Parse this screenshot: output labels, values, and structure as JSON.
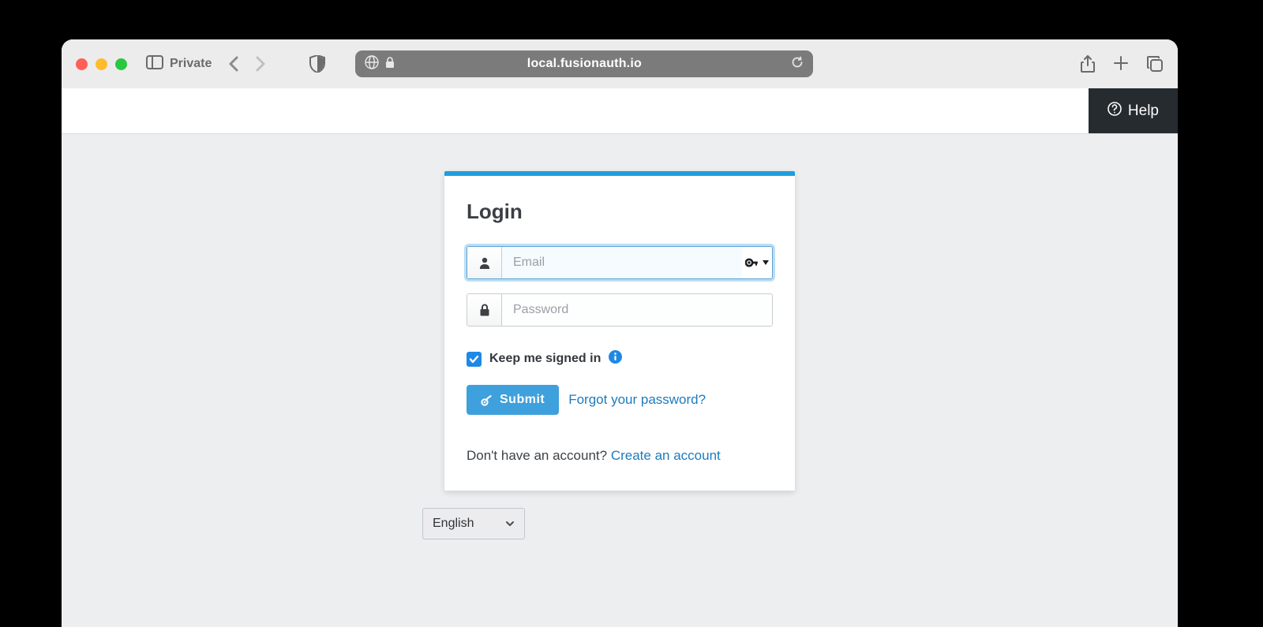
{
  "browser": {
    "mode_label": "Private",
    "url": "local.fusionauth.io"
  },
  "header": {
    "help_label": "Help"
  },
  "login": {
    "title": "Login",
    "email_placeholder": "Email",
    "password_placeholder": "Password",
    "remember_label": "Keep me signed in",
    "submit_label": "Submit",
    "forgot_label": "Forgot your password?",
    "no_account_label": "Don't have an account? ",
    "create_account_label": "Create an account"
  },
  "language": {
    "selected": "English"
  }
}
